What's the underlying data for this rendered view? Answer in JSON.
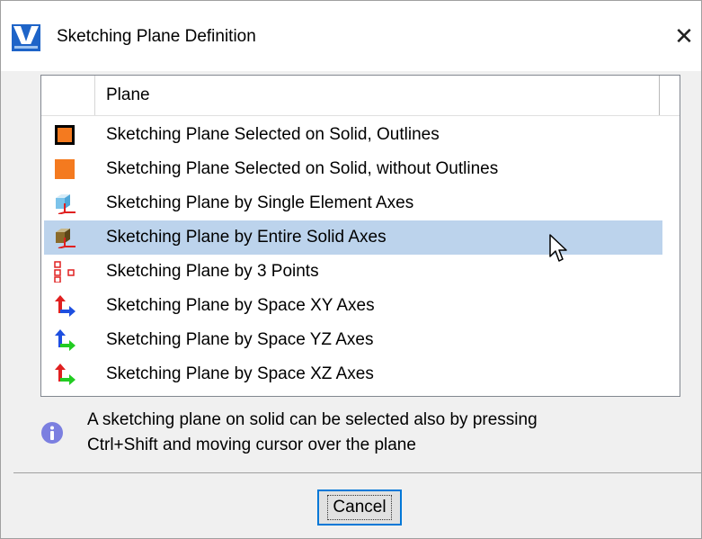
{
  "window": {
    "title": "Sketching Plane Definition",
    "close_glyph": "✕"
  },
  "list": {
    "column_header": "Plane",
    "rows": [
      {
        "label": "Sketching Plane Selected on Solid, Outlines",
        "icon": "orange-square-outlined-icon",
        "selected": false
      },
      {
        "label": "Sketching Plane Selected on Solid, without Outlines",
        "icon": "orange-square-icon",
        "selected": false
      },
      {
        "label": "Sketching Plane by Single Element Axes",
        "icon": "element-axes-icon",
        "selected": false
      },
      {
        "label": "Sketching Plane by Entire Solid Axes",
        "icon": "solid-axes-icon",
        "selected": true
      },
      {
        "label": "Sketching Plane by 3 Points",
        "icon": "three-points-icon",
        "selected": false
      },
      {
        "label": "Sketching Plane by Space XY Axes",
        "icon": "xy-axes-icon",
        "selected": false
      },
      {
        "label": "Sketching Plane by Space YZ Axes",
        "icon": "yz-axes-icon",
        "selected": false
      },
      {
        "label": "Sketching Plane by Space XZ Axes",
        "icon": "xz-axes-icon",
        "selected": false
      }
    ]
  },
  "info": {
    "icon": "info-icon",
    "line1": "A sketching plane on solid can be selected also by pressing",
    "line2": "Ctrl+Shift and moving cursor over the plane"
  },
  "buttons": {
    "cancel_label": "Cancel"
  },
  "colors": {
    "selection": "#bcd3ec",
    "orange": "#f47a1f",
    "focus_border": "#0078d7",
    "info_purple": "#7b7fe0"
  }
}
